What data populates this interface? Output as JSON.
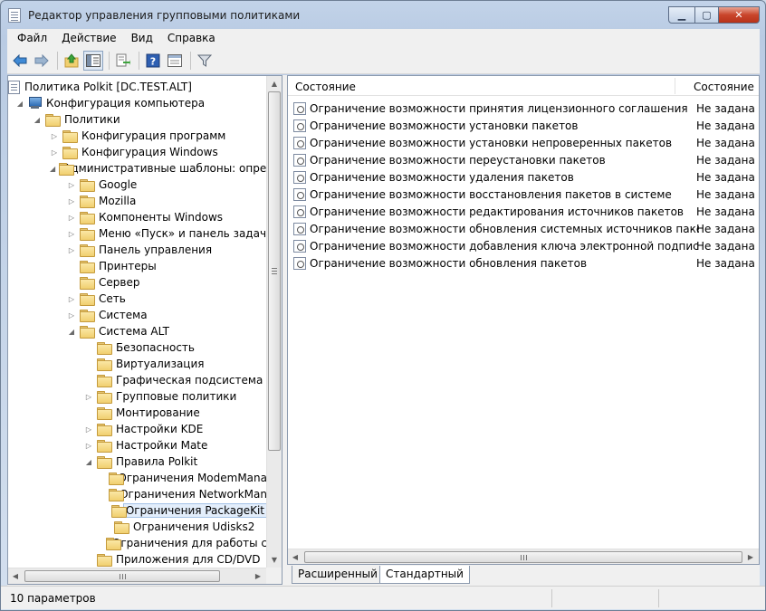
{
  "window": {
    "title": "Редактор управления групповыми политиками"
  },
  "menu": [
    "Файл",
    "Действие",
    "Вид",
    "Справка"
  ],
  "toolbar": {
    "buttons": [
      "back-icon",
      "forward-icon",
      "up-folder-icon",
      "show-hide-tree-icon",
      "export-list-icon",
      "help-icon",
      "extended-view-icon",
      "filter-icon"
    ]
  },
  "tree": {
    "items": [
      {
        "label": "Политика Polkit [DC.TEST.ALT]",
        "icon": "document-icon",
        "expander": "none"
      },
      {
        "label": "Конфигурация компьютера",
        "icon": "computer-icon",
        "expander": "expanded"
      },
      {
        "label": "Политики",
        "icon": "folder-icon",
        "expander": "expanded"
      },
      {
        "label": "Конфигурация программ",
        "icon": "folder-icon",
        "expander": "collapsed"
      },
      {
        "label": "Конфигурация Windows",
        "icon": "folder-icon",
        "expander": "collapsed"
      },
      {
        "label": "Административные шаблоны: опред",
        "icon": "folder-icon",
        "expander": "expanded"
      },
      {
        "label": "Google",
        "icon": "folder-icon",
        "expander": "collapsed"
      },
      {
        "label": "Mozilla",
        "icon": "folder-icon",
        "expander": "collapsed"
      },
      {
        "label": "Компоненты Windows",
        "icon": "folder-icon",
        "expander": "collapsed"
      },
      {
        "label": "Меню «Пуск» и панель задач",
        "icon": "folder-icon",
        "expander": "collapsed"
      },
      {
        "label": "Панель управления",
        "icon": "folder-icon",
        "expander": "collapsed"
      },
      {
        "label": "Принтеры",
        "icon": "folder-icon",
        "expander": "none"
      },
      {
        "label": "Сервер",
        "icon": "folder-icon",
        "expander": "none"
      },
      {
        "label": "Сеть",
        "icon": "folder-icon",
        "expander": "collapsed"
      },
      {
        "label": "Система",
        "icon": "folder-icon",
        "expander": "collapsed"
      },
      {
        "label": "Система ALT",
        "icon": "folder-icon",
        "expander": "expanded"
      },
      {
        "label": "Безопасность",
        "icon": "folder-icon",
        "expander": "none"
      },
      {
        "label": "Виртуализация",
        "icon": "folder-icon",
        "expander": "none"
      },
      {
        "label": "Графическая подсистема",
        "icon": "folder-icon",
        "expander": "none"
      },
      {
        "label": "Групповые политики",
        "icon": "folder-icon",
        "expander": "collapsed"
      },
      {
        "label": "Монтирование",
        "icon": "folder-icon",
        "expander": "none"
      },
      {
        "label": "Настройки KDE",
        "icon": "folder-icon",
        "expander": "collapsed"
      },
      {
        "label": "Настройки Mate",
        "icon": "folder-icon",
        "expander": "collapsed"
      },
      {
        "label": "Правила Polkit",
        "icon": "folder-icon",
        "expander": "expanded"
      },
      {
        "label": "Ограничения ModemMana",
        "icon": "folder-icon",
        "expander": "none"
      },
      {
        "label": "Ограничения NetworkMan",
        "icon": "folder-icon",
        "expander": "none"
      },
      {
        "label": "Ограничения PackageKit",
        "icon": "folder-icon",
        "expander": "none",
        "selected": true
      },
      {
        "label": "Ограничения Udisks2",
        "icon": "folder-icon",
        "expander": "none"
      },
      {
        "label": "Ограничения для работы с",
        "icon": "folder-icon",
        "expander": "none"
      },
      {
        "label": "Приложения для CD/DVD",
        "icon": "folder-icon",
        "expander": "none"
      }
    ]
  },
  "list": {
    "column_setting": "Состояние",
    "column_state": "Состояние",
    "rows": [
      {
        "name": "Ограничение возможности принятия лицензионного соглашения",
        "state": "Не задана"
      },
      {
        "name": "Ограничение возможности установки пакетов",
        "state": "Не задана"
      },
      {
        "name": "Ограничение возможности установки непроверенных пакетов",
        "state": "Не задана"
      },
      {
        "name": "Ограничение возможности переустановки пакетов",
        "state": "Не задана"
      },
      {
        "name": "Ограничение возможности удаления пакетов",
        "state": "Не задана"
      },
      {
        "name": "Ограничение возможности восстановления пакетов в системе",
        "state": "Не задана"
      },
      {
        "name": "Ограничение возможности редактирования источников пакетов",
        "state": "Не задана"
      },
      {
        "name": "Ограничение возможности обновления системных источников пакетов",
        "state": "Не задана"
      },
      {
        "name": "Ограничение возможности добавления ключа электронной подписи",
        "state": "Не задана"
      },
      {
        "name": "Ограничение возможности обновления пакетов",
        "state": "Не задана"
      }
    ]
  },
  "tabs": [
    {
      "label": "Расширенный",
      "active": false
    },
    {
      "label": "Стандартный",
      "active": true
    }
  ],
  "status": {
    "text": "10 параметров"
  },
  "colors": {
    "accent": "#3a6ea5",
    "selection": "#e3eefb"
  }
}
